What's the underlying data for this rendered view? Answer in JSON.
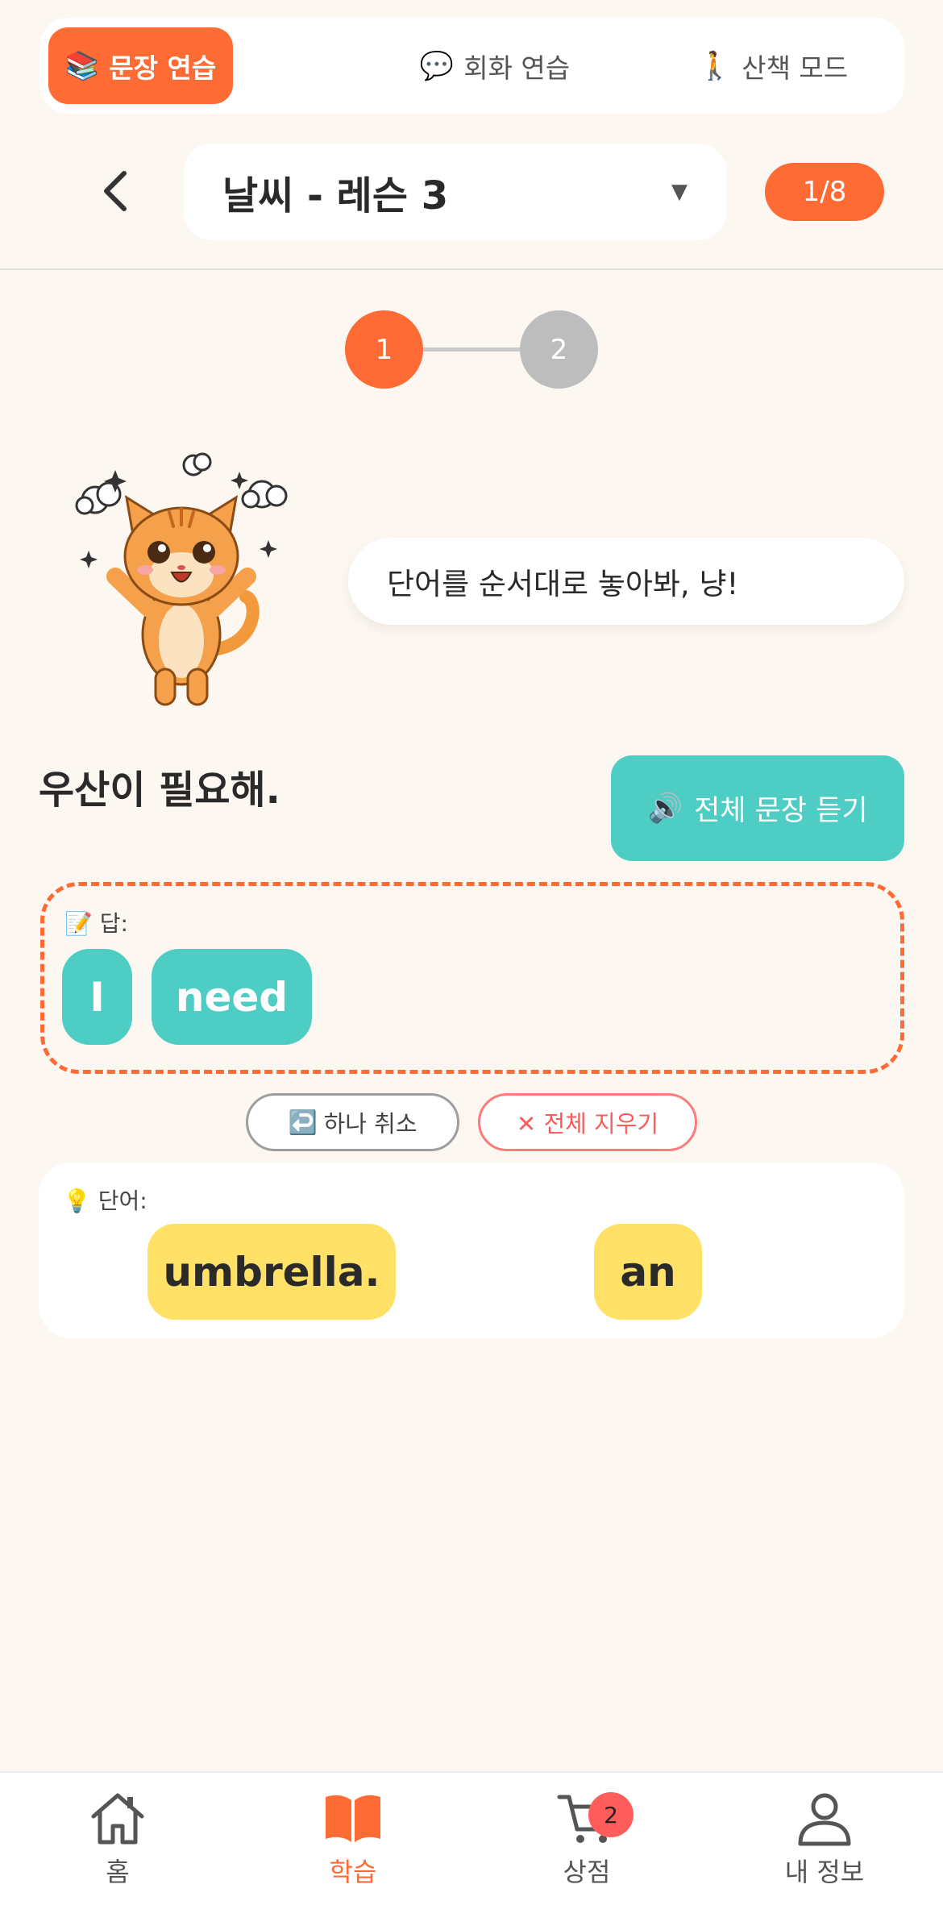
{
  "mode_tabs": [
    {
      "icon": "books-emoji",
      "emoji": "📚",
      "label": "문장 연습",
      "active": true
    },
    {
      "icon": "speech-bubble-emoji",
      "emoji": "💬",
      "label": "회화 연습",
      "active": false
    },
    {
      "icon": "walking-person-emoji",
      "emoji": "🚶",
      "label": "산책 모드",
      "active": false
    }
  ],
  "header": {
    "lesson_title": "날씨 - 레슨 3",
    "caret": "▼",
    "progress": "1/8"
  },
  "steps": {
    "step1": "1",
    "step2": "2",
    "current": 1
  },
  "mascot": {
    "speech": "단어를 순서대로 놓아봐, 냥!"
  },
  "exercise": {
    "sentence": "우산이 필요해.",
    "listen_emoji": "🔊",
    "listen_label": "전체 문장 듣기"
  },
  "answer": {
    "label_emoji": "📝",
    "label": "답:",
    "chips": [
      "I",
      "need"
    ]
  },
  "actions": {
    "undo_emoji": "↩️",
    "undo_label": "하나 취소",
    "clear_label": "✕ 전체 지우기"
  },
  "word_bank": {
    "label_emoji": "💡",
    "label": "단어:",
    "chips": [
      "umbrella.",
      "an"
    ]
  },
  "bottom_nav": [
    {
      "icon": "home-icon",
      "label": "홈",
      "active": false
    },
    {
      "icon": "book-icon",
      "label": "학습",
      "active": true
    },
    {
      "icon": "cart-icon",
      "label": "상점",
      "active": false,
      "badge": "2"
    },
    {
      "icon": "user-icon",
      "label": "내 정보",
      "active": false
    }
  ],
  "colors": {
    "accent": "#ff6b35",
    "teal": "#4ecdc4",
    "yellow": "#ffe168",
    "background": "#fdf7f2"
  }
}
